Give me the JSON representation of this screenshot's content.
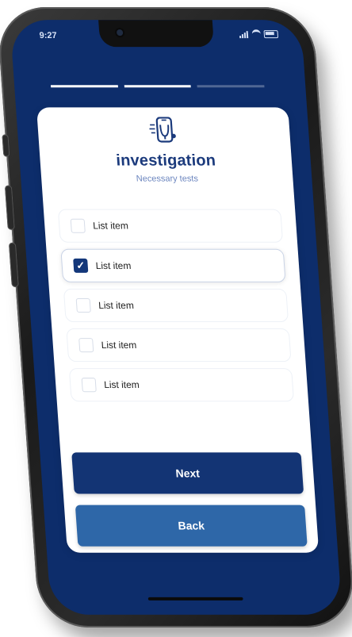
{
  "status_bar": {
    "time": "9:27",
    "icons": [
      "signal-icon",
      "wifi-icon",
      "battery-icon"
    ]
  },
  "progress": {
    "completed_steps": 2,
    "total_steps": 3
  },
  "header": {
    "title": "investigation",
    "subtitle": "Necessary tests",
    "logo_icon": "stethoscope-phone-icon"
  },
  "list": {
    "items": [
      {
        "label": "List item",
        "checked": false
      },
      {
        "label": "List item",
        "checked": true
      },
      {
        "label": "List item",
        "checked": false
      },
      {
        "label": "List item",
        "checked": false
      },
      {
        "label": "List item",
        "checked": false
      }
    ]
  },
  "buttons": {
    "next_label": "Next",
    "back_label": "Back"
  },
  "colors": {
    "screen_background": "#0d2d6b",
    "primary": "#133474",
    "secondary": "#2e67a8",
    "card": "#ffffff"
  }
}
